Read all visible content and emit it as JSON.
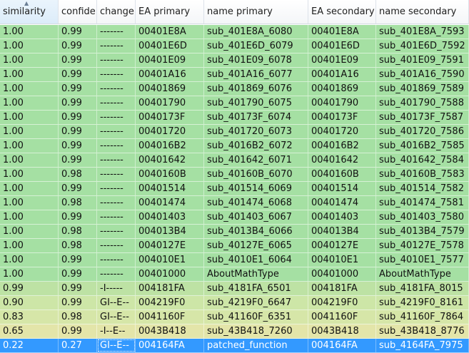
{
  "columns": [
    "similarity",
    "confide",
    "change",
    "EA primary",
    "name primary",
    "EA secondary",
    "name secondary"
  ],
  "colors": {
    "green": "#a5e0a3",
    "light_green": "#bde2a4",
    "pale_green": "#cde6a7",
    "yellow_green": "#d6e6a8",
    "khaki": "#e3e5a9",
    "selected": "#3399ff"
  },
  "rows": [
    {
      "cells": [
        "1.00",
        "0.99",
        "-------",
        "00401E8A",
        "sub_401E8A_6080",
        "00401E8A",
        "sub_401E8A_7593"
      ],
      "color": "green"
    },
    {
      "cells": [
        "1.00",
        "0.99",
        "-------",
        "00401E6D",
        "sub_401E6D_6079",
        "00401E6D",
        "sub_401E6D_7592"
      ],
      "color": "green"
    },
    {
      "cells": [
        "1.00",
        "0.99",
        "-------",
        "00401E09",
        "sub_401E09_6078",
        "00401E09",
        "sub_401E09_7591"
      ],
      "color": "green"
    },
    {
      "cells": [
        "1.00",
        "0.99",
        "-------",
        "00401A16",
        "sub_401A16_6077",
        "00401A16",
        "sub_401A16_7590"
      ],
      "color": "green"
    },
    {
      "cells": [
        "1.00",
        "0.99",
        "-------",
        "00401869",
        "sub_401869_6076",
        "00401869",
        "sub_401869_7589"
      ],
      "color": "green"
    },
    {
      "cells": [
        "1.00",
        "0.99",
        "-------",
        "00401790",
        "sub_401790_6075",
        "00401790",
        "sub_401790_7588"
      ],
      "color": "green"
    },
    {
      "cells": [
        "1.00",
        "0.99",
        "-------",
        "0040173F",
        "sub_40173F_6074",
        "0040173F",
        "sub_40173F_7587"
      ],
      "color": "green"
    },
    {
      "cells": [
        "1.00",
        "0.99",
        "-------",
        "00401720",
        "sub_401720_6073",
        "00401720",
        "sub_401720_7586"
      ],
      "color": "green"
    },
    {
      "cells": [
        "1.00",
        "0.99",
        "-------",
        "004016B2",
        "sub_4016B2_6072",
        "004016B2",
        "sub_4016B2_7585"
      ],
      "color": "green"
    },
    {
      "cells": [
        "1.00",
        "0.99",
        "-------",
        "00401642",
        "sub_401642_6071",
        "00401642",
        "sub_401642_7584"
      ],
      "color": "green"
    },
    {
      "cells": [
        "1.00",
        "0.98",
        "-------",
        "0040160B",
        "sub_40160B_6070",
        "0040160B",
        "sub_40160B_7583"
      ],
      "color": "green"
    },
    {
      "cells": [
        "1.00",
        "0.99",
        "-------",
        "00401514",
        "sub_401514_6069",
        "00401514",
        "sub_401514_7582"
      ],
      "color": "green"
    },
    {
      "cells": [
        "1.00",
        "0.98",
        "-------",
        "00401474",
        "sub_401474_6068",
        "00401474",
        "sub_401474_7581"
      ],
      "color": "green"
    },
    {
      "cells": [
        "1.00",
        "0.99",
        "-------",
        "00401403",
        "sub_401403_6067",
        "00401403",
        "sub_401403_7580"
      ],
      "color": "green"
    },
    {
      "cells": [
        "1.00",
        "0.98",
        "-------",
        "004013B4",
        "sub_4013B4_6066",
        "004013B4",
        "sub_4013B4_7579"
      ],
      "color": "green"
    },
    {
      "cells": [
        "1.00",
        "0.98",
        "-------",
        "0040127E",
        "sub_40127E_6065",
        "0040127E",
        "sub_40127E_7578"
      ],
      "color": "green"
    },
    {
      "cells": [
        "1.00",
        "0.99",
        "-------",
        "004010E1",
        "sub_4010E1_6064",
        "004010E1",
        "sub_4010E1_7577"
      ],
      "color": "green"
    },
    {
      "cells": [
        "1.00",
        "0.99",
        "-------",
        "00401000",
        "AboutMathType",
        "00401000",
        "AboutMathType"
      ],
      "color": "green"
    },
    {
      "cells": [
        "0.99",
        "0.99",
        "-I-----",
        "004181FA",
        "sub_4181FA_6501",
        "004181FA",
        "sub_4181FA_8015"
      ],
      "color": "light_green"
    },
    {
      "cells": [
        "0.90",
        "0.99",
        "GI--E--",
        "004219F0",
        "sub_4219F0_6647",
        "004219F0",
        "sub_4219F0_8161"
      ],
      "color": "pale_green"
    },
    {
      "cells": [
        "0.83",
        "0.98",
        "GI--E--",
        "0041160F",
        "sub_41160F_6351",
        "0041160F",
        "sub_41160F_7864"
      ],
      "color": "yellow_green"
    },
    {
      "cells": [
        "0.65",
        "0.99",
        "-I--E--",
        "0043B418",
        "sub_43B418_7260",
        "0043B418",
        "sub_43B418_8776"
      ],
      "color": "khaki"
    },
    {
      "cells": [
        "0.22",
        "0.27",
        "GI--E--",
        "004164FA",
        "patched_function",
        "004164FA",
        "sub_4164FA_7975"
      ],
      "color": "selected"
    }
  ]
}
